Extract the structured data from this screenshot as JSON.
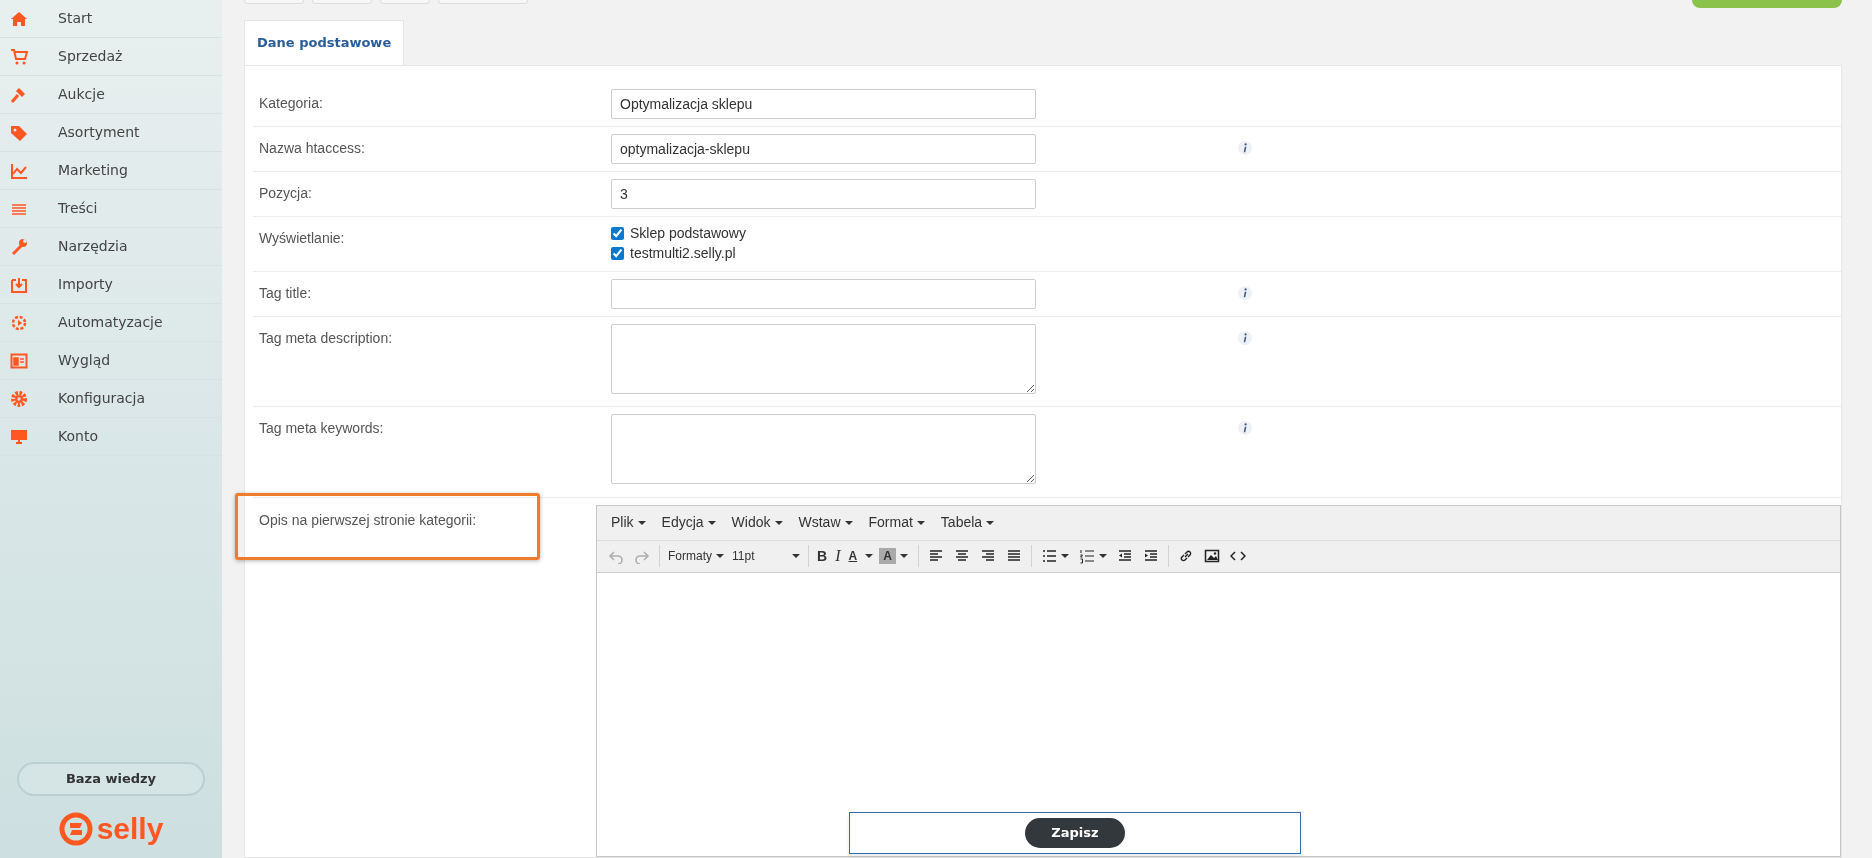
{
  "sidebar": {
    "items": [
      {
        "label": "Start"
      },
      {
        "label": "Sprzedaż"
      },
      {
        "label": "Aukcje"
      },
      {
        "label": "Asortyment"
      },
      {
        "label": "Marketing"
      },
      {
        "label": "Treści"
      },
      {
        "label": "Narzędzia"
      },
      {
        "label": "Importy"
      },
      {
        "label": "Automatyzacje"
      },
      {
        "label": "Wygląd"
      },
      {
        "label": "Konfiguracja"
      },
      {
        "label": "Konto"
      }
    ],
    "help_button": "Baza wiedzy",
    "logo": "selly"
  },
  "tabs": [
    {
      "label": "Dane podstawowe",
      "selected": true
    }
  ],
  "form": {
    "rows": [
      {
        "kind": "input",
        "label": "Kategoria:",
        "value": "Optymalizacja sklepu",
        "info": false,
        "highlighted": false
      },
      {
        "kind": "input",
        "label": "Nazwa htaccess:",
        "value": "optymalizacja-sklepu",
        "info": true,
        "highlighted": false
      },
      {
        "kind": "input",
        "label": "Pozycja:",
        "value": "3",
        "info": false,
        "highlighted": false
      },
      {
        "kind": "checks",
        "label": "Wyświetlanie:",
        "options": [
          {
            "label": "Sklep podstawowy",
            "checked": true
          },
          {
            "label": "testmulti2.selly.pl",
            "checked": true
          }
        ],
        "info": false,
        "highlighted": false
      },
      {
        "kind": "input",
        "label": "Tag title:",
        "info": true,
        "highlighted": false
      },
      {
        "kind": "textarea",
        "label": "Tag meta description:",
        "info": true,
        "highlighted": false
      },
      {
        "kind": "textarea",
        "label": "Tag meta keywords:",
        "info": true,
        "highlighted": false
      },
      {
        "kind": "editor",
        "label": "Opis na pierwszej stronie kategorii:",
        "info": false,
        "highlighted": true
      }
    ]
  },
  "editor": {
    "menu": [
      "Plik",
      "Edycja",
      "Widok",
      "Wstaw",
      "Format",
      "Tabela"
    ],
    "toolbar": [
      [
        {
          "kind": "undo",
          "disabled": true
        },
        {
          "kind": "redo",
          "disabled": true
        }
      ],
      [
        {
          "kind": "dropdown",
          "label": "Formaty",
          "disabled": false
        },
        {
          "kind": "select",
          "label": "11pt",
          "disabled": false
        }
      ],
      [
        {
          "kind": "bold",
          "label": "B",
          "disabled": false
        },
        {
          "kind": "italic",
          "label": "I",
          "disabled": false
        },
        {
          "kind": "textcolor",
          "label": "A",
          "disabled": false
        },
        {
          "kind": "bgcolor",
          "label": "A",
          "disabled": false
        }
      ],
      [
        {
          "kind": "alignleft",
          "disabled": false
        },
        {
          "kind": "aligncenter",
          "disabled": false
        },
        {
          "kind": "alignright",
          "disabled": false
        },
        {
          "kind": "justify",
          "disabled": false
        }
      ],
      [
        {
          "kind": "bullist",
          "disabled": false
        },
        {
          "kind": "numlist",
          "disabled": false
        },
        {
          "kind": "outdent",
          "disabled": false
        },
        {
          "kind": "indent",
          "disabled": false
        }
      ],
      [
        {
          "kind": "link",
          "disabled": false
        },
        {
          "kind": "image",
          "disabled": false
        },
        {
          "kind": "code",
          "disabled": false
        }
      ]
    ]
  },
  "save_button": "Zapisz"
}
